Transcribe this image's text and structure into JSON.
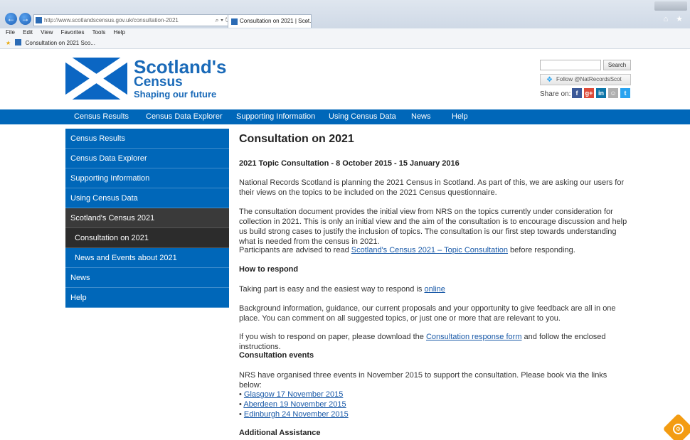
{
  "browser": {
    "address_url": "http://www.scotlandscensus.gov.uk/consultation-2021",
    "address_tools": "⌕ ▾ ↻",
    "tab_title": "Consultation on 2021 | Scot...",
    "tab_close": "×",
    "back_glyph": "←",
    "forward_glyph": "→",
    "win_icons": "⌂ ★",
    "menu": [
      "File",
      "Edit",
      "View",
      "Favorites",
      "Tools",
      "Help"
    ],
    "favorite_item": "Consultation on 2021  Sco..."
  },
  "header": {
    "logo_line1": "Scotland's",
    "logo_line2": "Census",
    "logo_line3": "Shaping our future",
    "search_button": "Search",
    "follow_label": "Follow @NatRecordsScot",
    "share_label": "Share on:",
    "share_icons": [
      {
        "label": "f",
        "color": "#3b5998"
      },
      {
        "label": "g+",
        "color": "#dd4b39"
      },
      {
        "label": "in",
        "color": "#0e76a8"
      },
      {
        "label": "☺",
        "color": "#b0b0b0"
      },
      {
        "label": "t",
        "color": "#2aa3ef"
      }
    ]
  },
  "topnav": [
    "Census Results",
    "Census Data Explorer",
    "Supporting Information",
    "Using Census Data",
    "News",
    "Help"
  ],
  "sidebar": [
    "Census Results",
    "Census Data Explorer",
    "Supporting Information",
    "Using Census Data",
    "Scotland's Census 2021",
    "Consultation on 2021",
    "News and Events about 2021",
    "News",
    "Help"
  ],
  "content": {
    "title": "Consultation on 2021",
    "subtitle": "2021 Topic Consultation - 8 October 2015 - 15 January 2016",
    "p1": "National Records Scotland is planning the 2021 Census in Scotland. As part of this, we are asking our users for their views on the topics to be included on the 2021 Census questionnaire.",
    "p2": "The consultation document provides the initial view from NRS on the topics currently under consideration for collection in 2021. This is only an initial view and the aim of the consultation is to encourage discussion and help us build strong cases to justify the inclusion of topics. The consultation is our first step towards understanding what is needed from the census in 2021.",
    "p3_before": "Participants are advised to read ",
    "p3_link": "Scotland's Census 2021 – Topic Consultation",
    "p3_after": " before responding.",
    "h_respond": "How to respond",
    "p4_before": "Taking part is easy and the easiest way to respond is ",
    "p4_link": "online",
    "p5": "Background information, guidance, our current proposals and your opportunity to give feedback are all in one place. You can comment on all suggested topics, or just one or more that are relevant to you.",
    "p6_before": "If you wish to respond on paper, please download the ",
    "p6_link": "Consultation response form",
    "p6_after": " and follow the enclosed instructions.",
    "h_events": "Consultation events",
    "p7": "NRS have organised three events in November 2015 to support the consultation. Please book via the links below:",
    "bullet": "• ",
    "events": [
      "Glasgow 17 November 2015",
      "Aberdeen 19 November 2015",
      "Edinburgh 24 November 2015"
    ],
    "h_assist": "Additional Assistance"
  },
  "colors": {
    "brand_blue": "#0067b9",
    "sidebar_dark": "#3a3a3a",
    "link": "#1a5aa8",
    "help_orange": "#f39c12"
  },
  "help_fab_icon": "⚙"
}
